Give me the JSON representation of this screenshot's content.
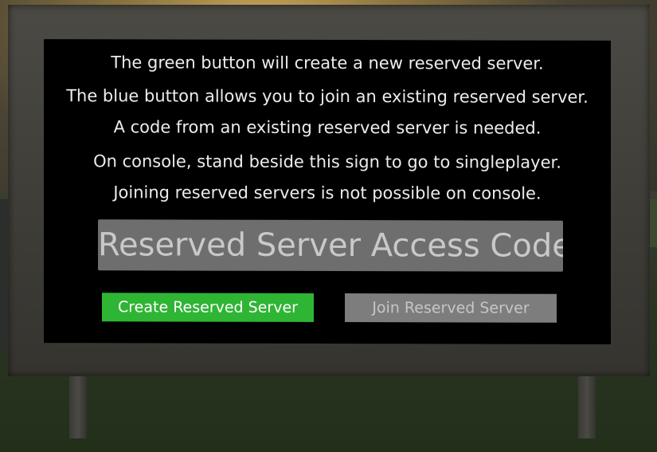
{
  "sign": {
    "lines": [
      "The green button will create a new reserved server.",
      "The blue button allows you to join an existing reserved server.",
      "A code from an existing reserved server is needed.",
      "On console, stand beside this sign to go to singleplayer.",
      "Joining reserved servers is not possible on console."
    ],
    "code_input": {
      "placeholder": "Reserved Server Access Code",
      "value": ""
    },
    "buttons": {
      "create_label": "Create Reserved Server",
      "join_label": "Join Reserved Server"
    }
  },
  "colors": {
    "board_background": "#000000",
    "create_button": "#2fb534",
    "join_button": "#7d7d7d",
    "code_box": "#6e6e6e"
  }
}
